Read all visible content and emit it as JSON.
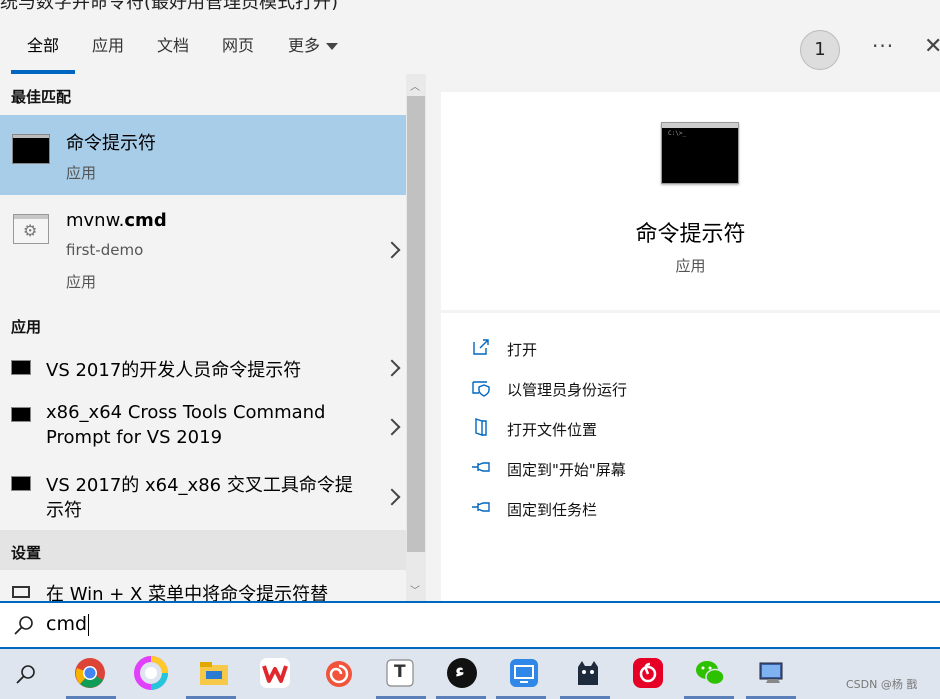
{
  "window_title_partial": "统与数字并命令符(最好用管理员模式打开)",
  "tabs": [
    {
      "label": "全部"
    },
    {
      "label": "应用"
    },
    {
      "label": "文档"
    },
    {
      "label": "网页"
    },
    {
      "label": "更多"
    }
  ],
  "badge_count": "1",
  "more_options": "···",
  "close": "✕",
  "sections": {
    "best_match": "最佳匹配",
    "apps": "应用",
    "settings": "设置"
  },
  "best_match": {
    "title": "命令提示符",
    "subtitle": "应用"
  },
  "file_result": {
    "title_plain": "mvnw.",
    "title_bold": "cmd",
    "path": "first-demo",
    "type": "应用"
  },
  "apps": [
    {
      "line1": "VS 2017的开发人员命令提示符",
      "line2": ""
    },
    {
      "line1": "x86_x64 Cross Tools Command",
      "line2": "Prompt for VS 2019"
    },
    {
      "line1": "VS 2017的 x64_x86 交叉工具命令提",
      "line2": "示符"
    }
  ],
  "settings_item": "在 Win + X 菜单中将命令提示符替",
  "details": {
    "title": "命令提示符",
    "subtitle": "应用",
    "icon_caption": "C:\\>_",
    "actions": [
      {
        "label": "打开",
        "icon": "open-external-icon"
      },
      {
        "label": "以管理员身份运行",
        "icon": "shield-admin-icon"
      },
      {
        "label": "打开文件位置",
        "icon": "file-location-icon"
      },
      {
        "label": "固定到\"开始\"屏幕",
        "icon": "pin-icon"
      },
      {
        "label": "固定到任务栏",
        "icon": "pin-icon"
      }
    ]
  },
  "search": {
    "value": "cmd"
  },
  "taskbar": {
    "watermark": "CSDN @杨 戬",
    "text_app_glyph": "T",
    "typora_glyph": "ء"
  },
  "colors": {
    "accent": "#0067c0",
    "selected_bg": "#a8cde8",
    "panel_bg": "#f3f3f3"
  }
}
